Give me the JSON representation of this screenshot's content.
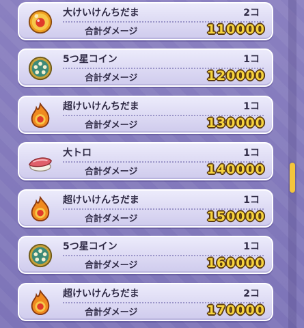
{
  "items": [
    {
      "icon": "big-orb-icon",
      "name": "大けいけんちだま",
      "qty": "2コ",
      "damage_label": "合計ダメージ",
      "damage": "110000"
    },
    {
      "icon": "five-star-coin-icon",
      "name": "5つ星コイン",
      "qty": "1コ",
      "damage_label": "合計ダメージ",
      "damage": "120000"
    },
    {
      "icon": "super-orb-icon",
      "name": "超けいけんちだま",
      "qty": "1コ",
      "damage_label": "合計ダメージ",
      "damage": "130000"
    },
    {
      "icon": "fatty-tuna-sushi-icon",
      "name": "大トロ",
      "qty": "1コ",
      "damage_label": "合計ダメージ",
      "damage": "140000"
    },
    {
      "icon": "super-orb-icon",
      "name": "超けいけんちだま",
      "qty": "1コ",
      "damage_label": "合計ダメージ",
      "damage": "150000"
    },
    {
      "icon": "five-star-coin-icon",
      "name": "5つ星コイン",
      "qty": "1コ",
      "damage_label": "合計ダメージ",
      "damage": "160000"
    },
    {
      "icon": "super-orb-icon",
      "name": "超けいけんちだま",
      "qty": "2コ",
      "damage_label": "合計ダメージ",
      "damage": "170000"
    }
  ],
  "colors": {
    "damage_text": "#f6d33e",
    "scroll_thumb": "#f4c53c",
    "background": "#8a80c0"
  }
}
